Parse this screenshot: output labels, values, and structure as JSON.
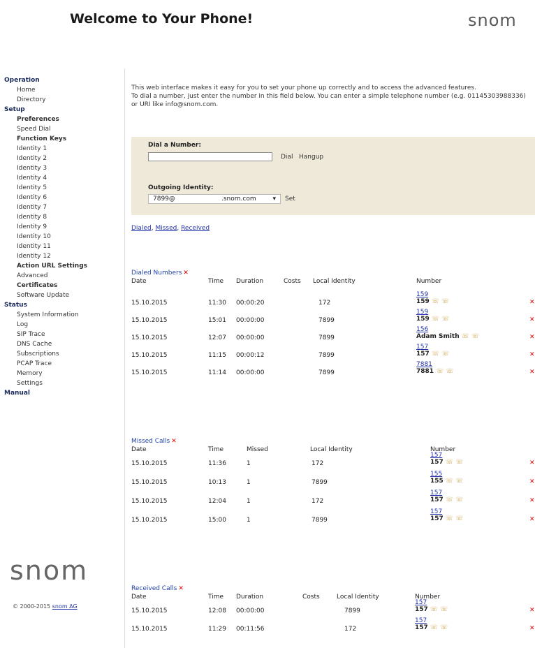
{
  "header": {
    "title": "Welcome to Your Phone!",
    "logo": "snom"
  },
  "sidebar": {
    "groups": [
      {
        "label": "Operation",
        "items": [
          {
            "label": "Home"
          },
          {
            "label": "Directory"
          }
        ]
      },
      {
        "label": "Setup",
        "items": [
          {
            "label": "Preferences"
          },
          {
            "label": "Speed Dial"
          },
          {
            "label": "Function Keys"
          },
          {
            "label": "Identity 1"
          },
          {
            "label": "Identity 2"
          },
          {
            "label": "Identity 3"
          },
          {
            "label": "Identity 4"
          },
          {
            "label": "Identity 5"
          },
          {
            "label": "Identity 6"
          },
          {
            "label": "Identity 7"
          },
          {
            "label": "Identity 8"
          },
          {
            "label": "Identity 9"
          },
          {
            "label": "Identity 10"
          },
          {
            "label": "Identity 11"
          },
          {
            "label": "Identity 12"
          },
          {
            "label": "Action URL Settings"
          },
          {
            "label": "Advanced"
          },
          {
            "label": "Certificates"
          },
          {
            "label": "Software Update"
          }
        ]
      },
      {
        "label": "Status",
        "items": [
          {
            "label": "System Information"
          },
          {
            "label": "Log"
          },
          {
            "label": "SIP Trace"
          },
          {
            "label": "DNS Cache"
          },
          {
            "label": "Subscriptions"
          },
          {
            "label": "PCAP Trace"
          },
          {
            "label": "Memory"
          },
          {
            "label": "Settings"
          }
        ]
      },
      {
        "label": "Manual",
        "items": []
      }
    ],
    "logo": "snom",
    "copyright": "© 2000-2015",
    "copyright_link": "snom AG"
  },
  "intro": {
    "line1": "This web interface makes it easy for you to set your phone up correctly and to access the advanced features.",
    "line2": "To dial a number, just enter the number in this field below. You can enter a simple telephone number (e.g. 01145303988336) or URI like info@snom.com."
  },
  "dial": {
    "label": "Dial a Number:",
    "input_value": "",
    "dial_button": "Dial",
    "hangup_button": "Hangup",
    "outgoing_label": "Outgoing Identity:",
    "identity_user": "7899@",
    "identity_domain": ".snom.com",
    "set_button": "Set"
  },
  "links": {
    "dialed": "Dialed",
    "missed": "Missed",
    "received": "Received"
  },
  "dialed": {
    "title": "Dialed Numbers",
    "headers": {
      "date": "Date",
      "time": "Time",
      "duration": "Duration",
      "costs": "Costs",
      "identity": "Local Identity",
      "number": "Number"
    },
    "rows": [
      {
        "date": "15.10.2015",
        "time": "11:30",
        "duration": "00:00:20",
        "identity": "172",
        "link": "159",
        "num": "159"
      },
      {
        "date": "15.10.2015",
        "time": "15:01",
        "duration": "00:00:00",
        "identity": "7899",
        "link": "159",
        "num": "159"
      },
      {
        "date": "15.10.2015",
        "time": "12:07",
        "duration": "00:00:00",
        "identity": "7899",
        "link": "156",
        "num": "Adam Smith"
      },
      {
        "date": "15.10.2015",
        "time": "11:15",
        "duration": "00:00:12",
        "identity": "7899",
        "link": "157",
        "num": "157"
      },
      {
        "date": "15.10.2015",
        "time": "11:14",
        "duration": "00:00:00",
        "identity": "7899",
        "link": "7881",
        "num": "7881"
      }
    ]
  },
  "missed": {
    "title": "Missed Calls",
    "headers": {
      "date": "Date",
      "time": "Time",
      "missed": "Missed",
      "identity": "Local Identity",
      "number": "Number"
    },
    "rows": [
      {
        "date": "15.10.2015",
        "time": "11:36",
        "missed": "1",
        "identity": "172",
        "link": "157",
        "num": "157"
      },
      {
        "date": "15.10.2015",
        "time": "10:13",
        "missed": "1",
        "identity": "7899",
        "link": "155",
        "num": "155"
      },
      {
        "date": "15.10.2015",
        "time": "12:04",
        "missed": "1",
        "identity": "172",
        "link": "157",
        "num": "157"
      },
      {
        "date": "15.10.2015",
        "time": "15:00",
        "missed": "1",
        "identity": "7899",
        "link": "157",
        "num": "157"
      }
    ]
  },
  "received": {
    "title": "Received Calls",
    "headers": {
      "date": "Date",
      "time": "Time",
      "duration": "Duration",
      "costs": "Costs",
      "identity": "Local Identity",
      "number": "Number"
    },
    "rows": [
      {
        "date": "15.10.2015",
        "time": "12:08",
        "duration": "00:00:00",
        "identity": "7899",
        "link": "157",
        "num": "157"
      },
      {
        "date": "15.10.2015",
        "time": "11:29",
        "duration": "00:11:56",
        "identity": "172",
        "link": "157",
        "num": "157"
      }
    ]
  },
  "icons": {
    "delete": "delete-x-icon",
    "call": "phone-icon"
  },
  "colors": {
    "link": "#2233aa",
    "delete": "#dd0000",
    "dial_bg": "#efe9d9",
    "sidebar_head": "#1a2a5a"
  }
}
